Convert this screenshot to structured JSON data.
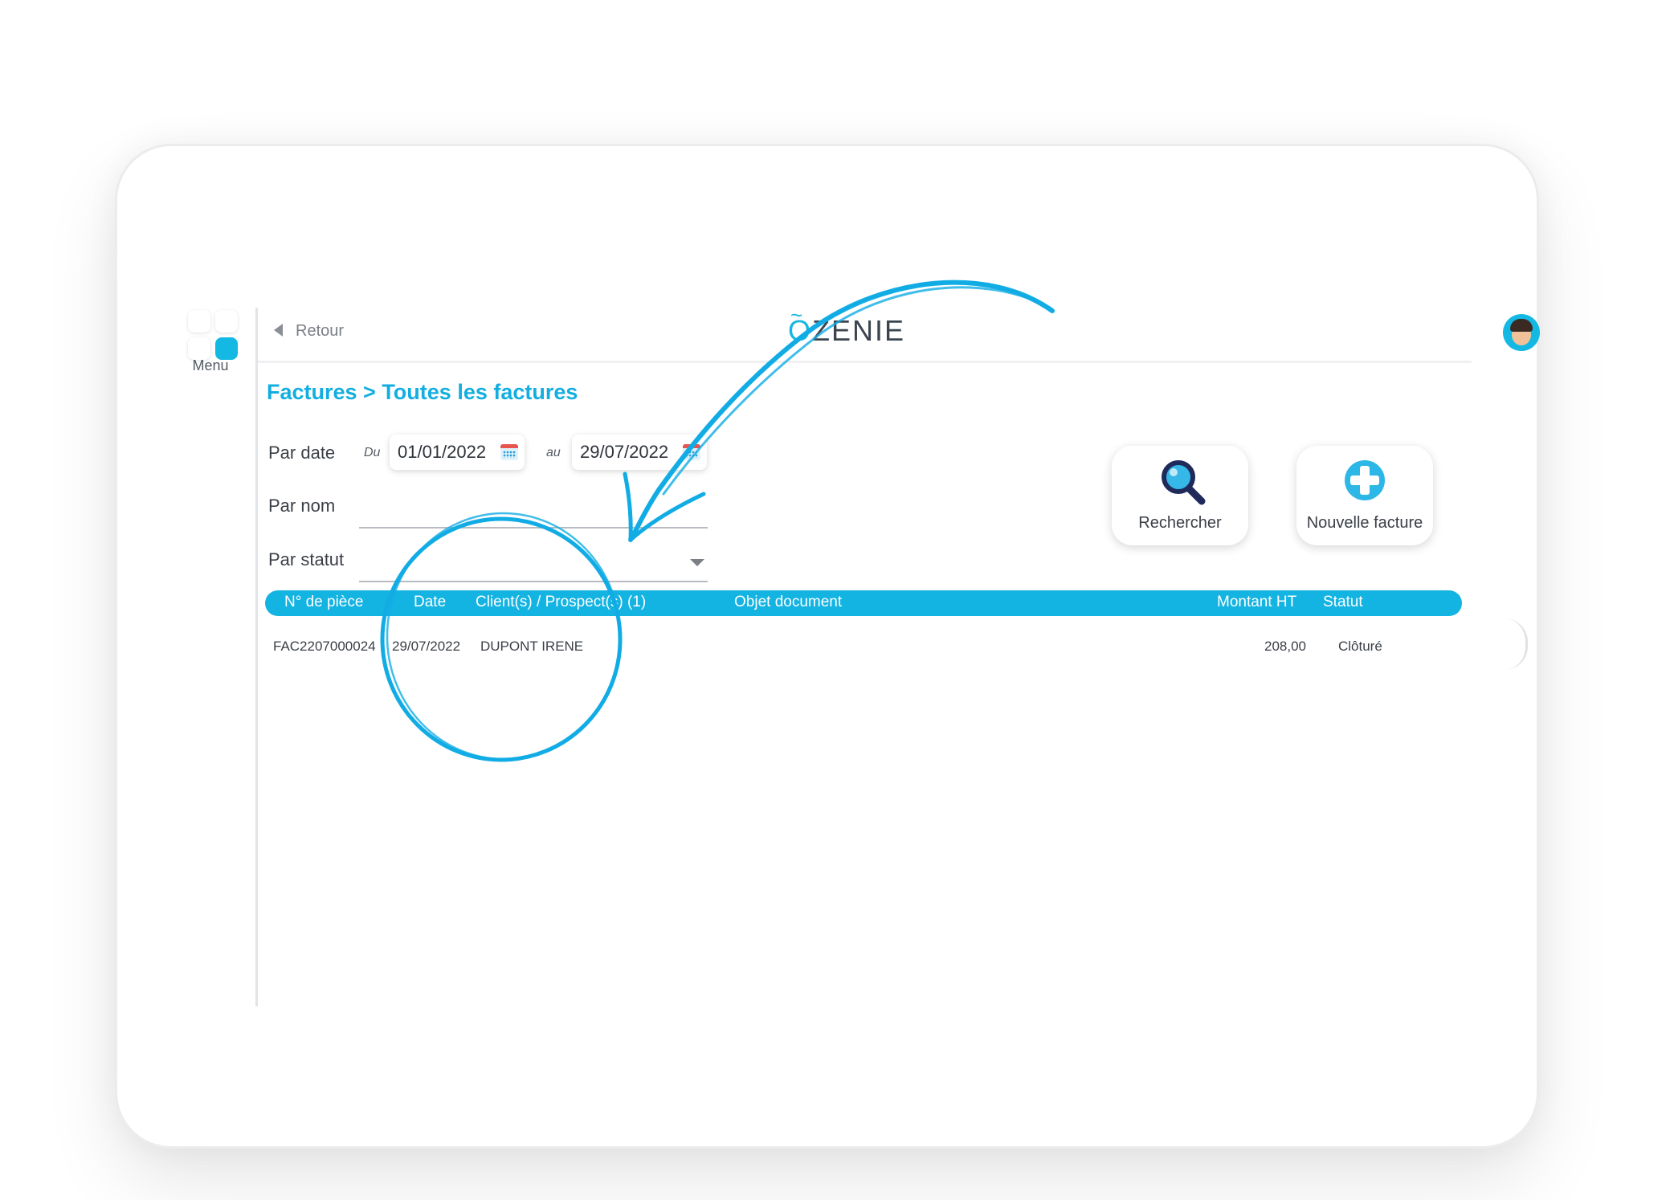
{
  "menu": {
    "label": "Menu"
  },
  "topbar": {
    "back_label": "Retour",
    "logo_text": "ZENIE",
    "logo_letter": "O",
    "logo_tilde": "~"
  },
  "breadcrumb": "Factures > Toutes les factures",
  "filters": {
    "by_date_label": "Par date",
    "from_label": "Du",
    "from_value": "01/01/2022",
    "to_label": "au",
    "to_value": "29/07/2022",
    "by_name_label": "Par nom",
    "by_name_value": "",
    "by_status_label": "Par statut",
    "by_status_value": ""
  },
  "actions": {
    "search_label": "Rechercher",
    "new_label": "Nouvelle facture"
  },
  "table": {
    "headers": [
      "N° de pièce",
      "Date",
      "Client(s) / Prospect(s) (1)",
      "Objet document",
      "Montant HT",
      "Statut"
    ],
    "rows": [
      {
        "piece": "FAC2207000024",
        "date": "29/07/2022",
        "client": "DUPONT IRENE",
        "objet": "",
        "montant": "208,00",
        "statut": "Clôturé"
      }
    ]
  },
  "colors": {
    "accent": "#13b3e2",
    "annotation": "#12ace5"
  },
  "icons": [
    "search-icon",
    "plus-icon",
    "calendar-icon",
    "back-arrow-icon",
    "dropdown-caret-icon",
    "avatar"
  ]
}
